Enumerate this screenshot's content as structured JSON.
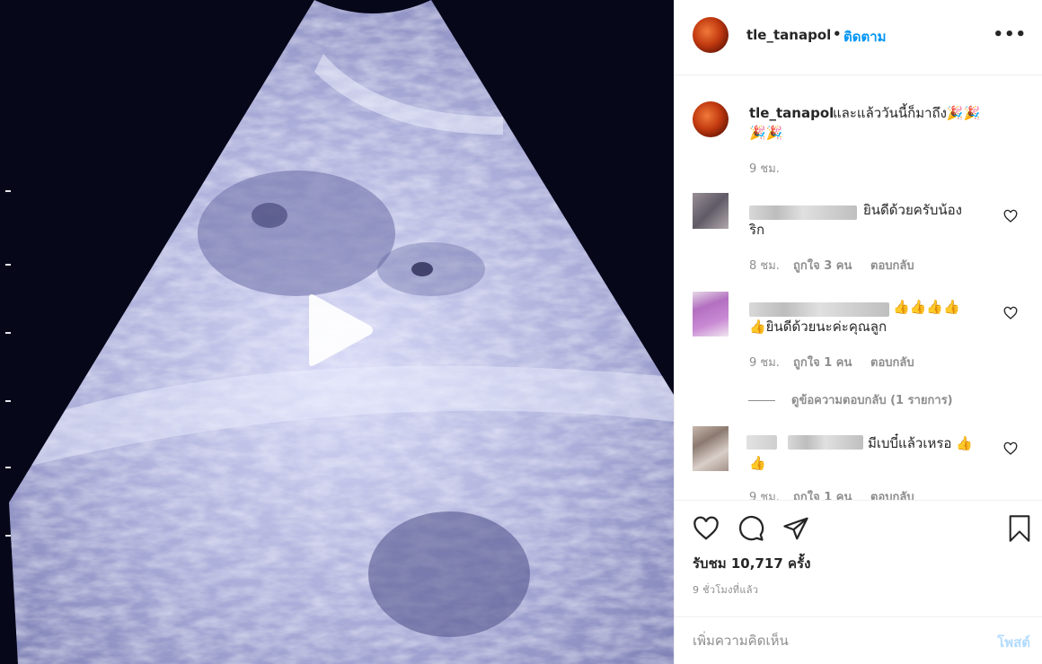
{
  "header": {
    "username": "tle_tanapol",
    "separator": "•",
    "follow_label": "ติดตาม",
    "more_label": "•••"
  },
  "caption": {
    "username": "tle_tanapol",
    "text_line1": "และแล้ววันนี้ก็มาถึง🎉🎉",
    "text_line2": "🎉🎉",
    "time": "9 ชม."
  },
  "comments": [
    {
      "text_line1": "ยินดีด้วยครับน้อง",
      "text_line2": "ริก",
      "time": "8 ชม.",
      "likes": "ถูกใจ 3 คน",
      "reply": "ตอบกลับ"
    },
    {
      "text_line1": "👍👍👍👍",
      "text_line2": "👍ยินดีด้วยนะค่ะคุณลูก",
      "time": "9 ชม.",
      "likes": "ถูกใจ 1 คน",
      "reply": "ตอบกลับ",
      "view_replies": "ดูข้อความตอบกลับ (1 รายการ)"
    },
    {
      "text_line1": "มีเบบี๋แล้วเหรอ 👍",
      "text_line2": "👍",
      "time": "9 ชม.",
      "likes": "ถูกใจ 1 คน",
      "reply": "ตอบกลับ"
    }
  ],
  "actions": {
    "views": "รับชม 10,717 ครั้ง",
    "time_ago": "9 ชั่วโมงที่แล้ว"
  },
  "add_comment": {
    "placeholder": "เพิ่มความคิดเห็น",
    "post_label": "โพสต์"
  },
  "colors": {
    "link_blue": "#0095f6",
    "post_disabled": "#b3dbff",
    "muted": "#8e8e8e",
    "media_bg": "#07071a"
  }
}
